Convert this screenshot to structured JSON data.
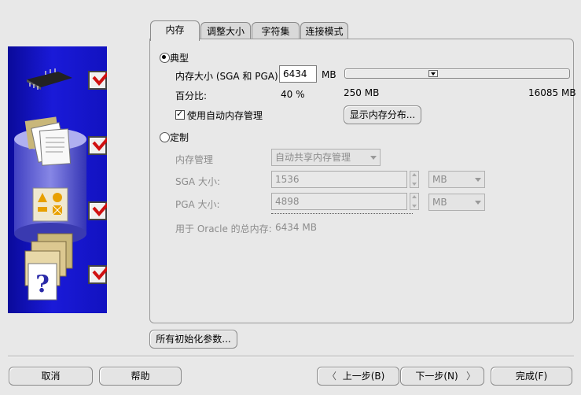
{
  "tabs": [
    {
      "label": "内存",
      "active": true
    },
    {
      "label": "调整大小",
      "active": false
    },
    {
      "label": "字符集",
      "active": false
    },
    {
      "label": "连接模式",
      "active": false
    }
  ],
  "typical": {
    "radio_label": "典型",
    "selected": true,
    "memory_size_label": "内存大小 (SGA 和 PGA):",
    "memory_size_value": "6434",
    "memory_unit": "MB",
    "percent_label": "百分比:",
    "percent_value": "40 %",
    "slider_min_label": "250 MB",
    "slider_max_label": "16085 MB",
    "slider_position": 0.39,
    "auto_mem_label": "使用自动内存管理",
    "auto_mem_checked": true,
    "show_distribution_label": "显示内存分布..."
  },
  "custom": {
    "radio_label": "定制",
    "selected": false,
    "mem_mgmt_label": "内存管理",
    "mem_mgmt_value": "自动共享内存管理",
    "sga_label": "SGA 大小:",
    "sga_value": "1536",
    "sga_unit": "MB",
    "pga_label": "PGA 大小:",
    "pga_value": "4898",
    "pga_unit": "MB",
    "total_label": "用于 Oracle 的总内存:",
    "total_value": "6434 MB"
  },
  "all_params_label": "所有初始化参数...",
  "footer": {
    "cancel": "取消",
    "help": "帮助",
    "back": "上一步(B)",
    "next": "下一步(N)",
    "finish": "完成(F)"
  },
  "colors": {
    "panel_blue": "#1a1ad8",
    "check_red": "#d01010"
  }
}
